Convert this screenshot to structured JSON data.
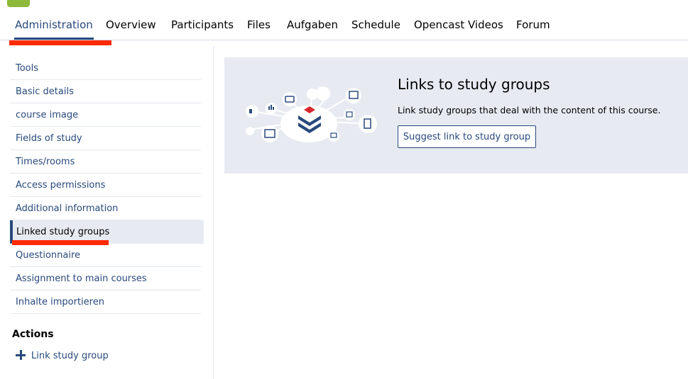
{
  "tabs": [
    {
      "label": "Administration"
    },
    {
      "label": "Overview"
    },
    {
      "label": "Participants"
    },
    {
      "label": "Files"
    },
    {
      "label": "Aufgaben"
    },
    {
      "label": "Schedule"
    },
    {
      "label": "Opencast Videos"
    },
    {
      "label": "Forum"
    }
  ],
  "sidebar": {
    "items": [
      {
        "label": "Tools"
      },
      {
        "label": "Basic details"
      },
      {
        "label": "course image"
      },
      {
        "label": "Fields of study"
      },
      {
        "label": "Times/rooms"
      },
      {
        "label": "Access permissions"
      },
      {
        "label": "Additional information"
      },
      {
        "label": "Linked study groups"
      },
      {
        "label": "Questionnaire"
      },
      {
        "label": "Assignment to main courses"
      },
      {
        "label": "Inhalte importieren"
      }
    ],
    "actions_title": "Actions",
    "actions": [
      {
        "label": "Link study group"
      }
    ]
  },
  "panel": {
    "title": "Links to study groups",
    "description": "Link study groups that deal with the content of this course.",
    "button_label": "Suggest link to study group"
  },
  "colors": {
    "accent": "#28497c",
    "highlight": "#ff2a00",
    "panel_bg": "#e7ebf1"
  }
}
